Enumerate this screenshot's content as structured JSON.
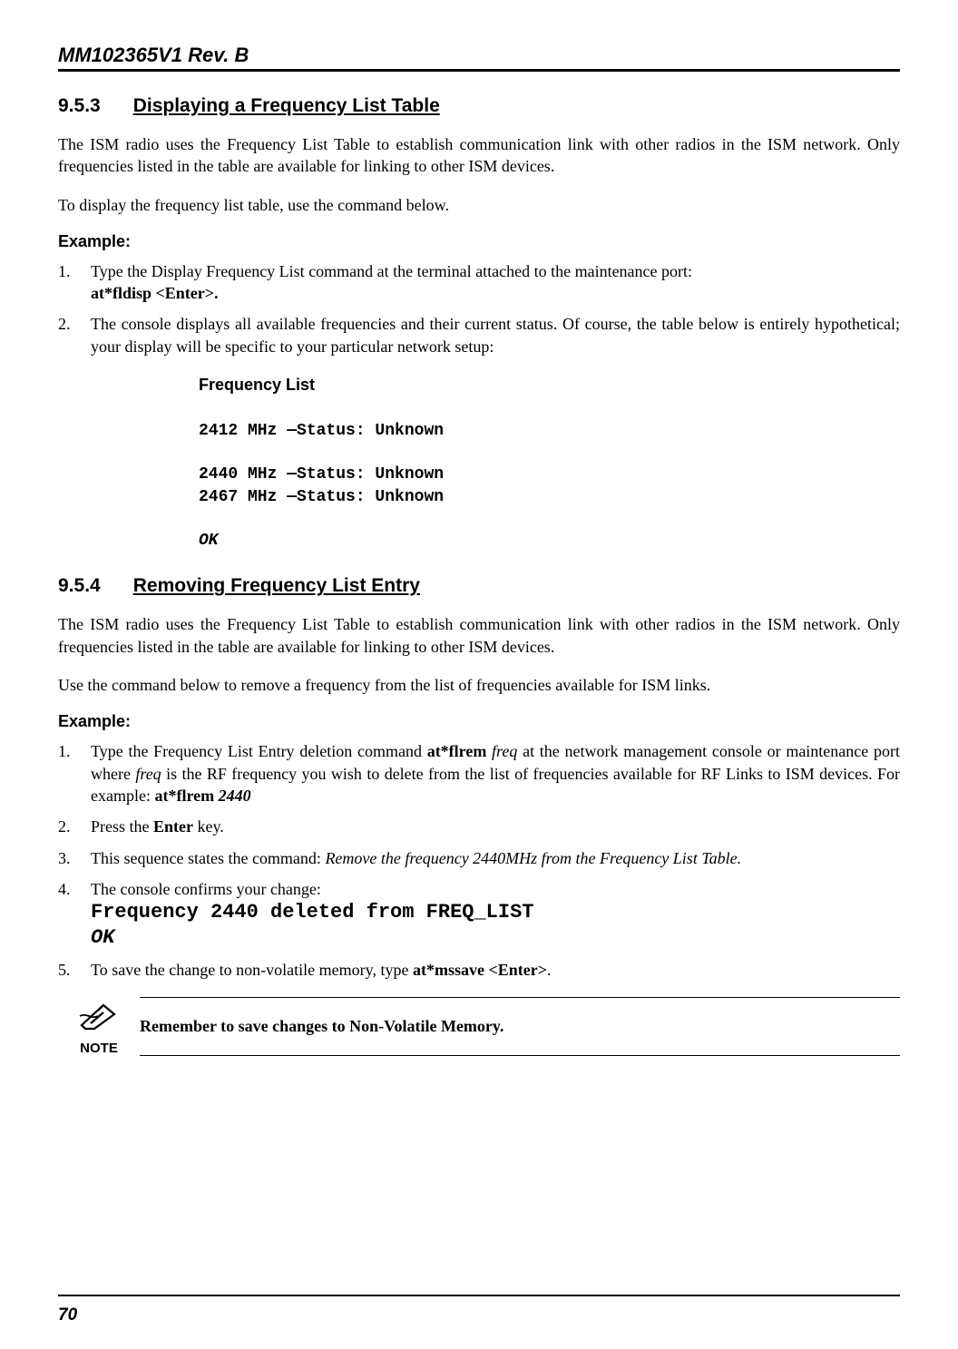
{
  "header": {
    "docid": "MM102365V1 Rev. B"
  },
  "page_number": "70",
  "s953": {
    "num": "9.5.3",
    "title": "Displaying a Frequency List Table",
    "para1": "The ISM radio uses the Frequency List Table to establish communication link with other radios in the ISM network. Only frequencies listed in the table are available for linking to other ISM devices.",
    "para2": "To display the frequency list table, use the command below.",
    "example_label": "Example:",
    "step1_text": "Type the Display Frequency List command at the terminal attached to the maintenance port:",
    "step1_cmd": "at*fldisp <Enter>.",
    "step2_text": "The console displays all available frequencies and their current status. Of course, the table below is entirely hypothetical; your display will be specific to your particular network setup:",
    "code_header": "Frequency List",
    "code_line1": "2412 MHz —Status: Unknown",
    "code_line2": "2440 MHz —Status: Unknown",
    "code_line3": "2467 MHz —Status: Unknown",
    "code_ok": "OK"
  },
  "s954": {
    "num": "9.5.4",
    "title": "Removing Frequency List Entry",
    "para1": "The ISM radio uses the Frequency List Table to establish communication link with other radios in the ISM network. Only frequencies listed in the table are available for linking to other ISM devices.",
    "para2": "Use the command below to remove a frequency from the list of frequencies available for ISM links.",
    "example_label": "Example:",
    "step1_a": "Type the Frequency List Entry deletion command ",
    "step1_b": "at*flrem ",
    "step1_c": "freq",
    "step1_d": " at the network management console or maintenance port where ",
    "step1_e": "freq",
    "step1_f": " is the RF frequency you wish to delete from the list of frequencies available for RF Links to ISM devices. For example: ",
    "step1_g": "at*flrem ",
    "step1_h": "2440",
    "step2_a": "Press the ",
    "step2_b": "Enter",
    "step2_c": " key.",
    "step3_a": "This sequence states the command: ",
    "step3_b": "Remove the frequency 2440MHz from the Frequency List Table.",
    "step4": "The console confirms your change:",
    "code_line1": "Frequency 2440 deleted from FREQ_LIST",
    "code_ok": "OK",
    "step5_a": "To save the change to non-volatile memory, type ",
    "step5_b": "at*mssave <Enter>",
    "step5_c": "."
  },
  "note": {
    "label": "NOTE",
    "text": "Remember to save changes to Non-Volatile Memory."
  }
}
